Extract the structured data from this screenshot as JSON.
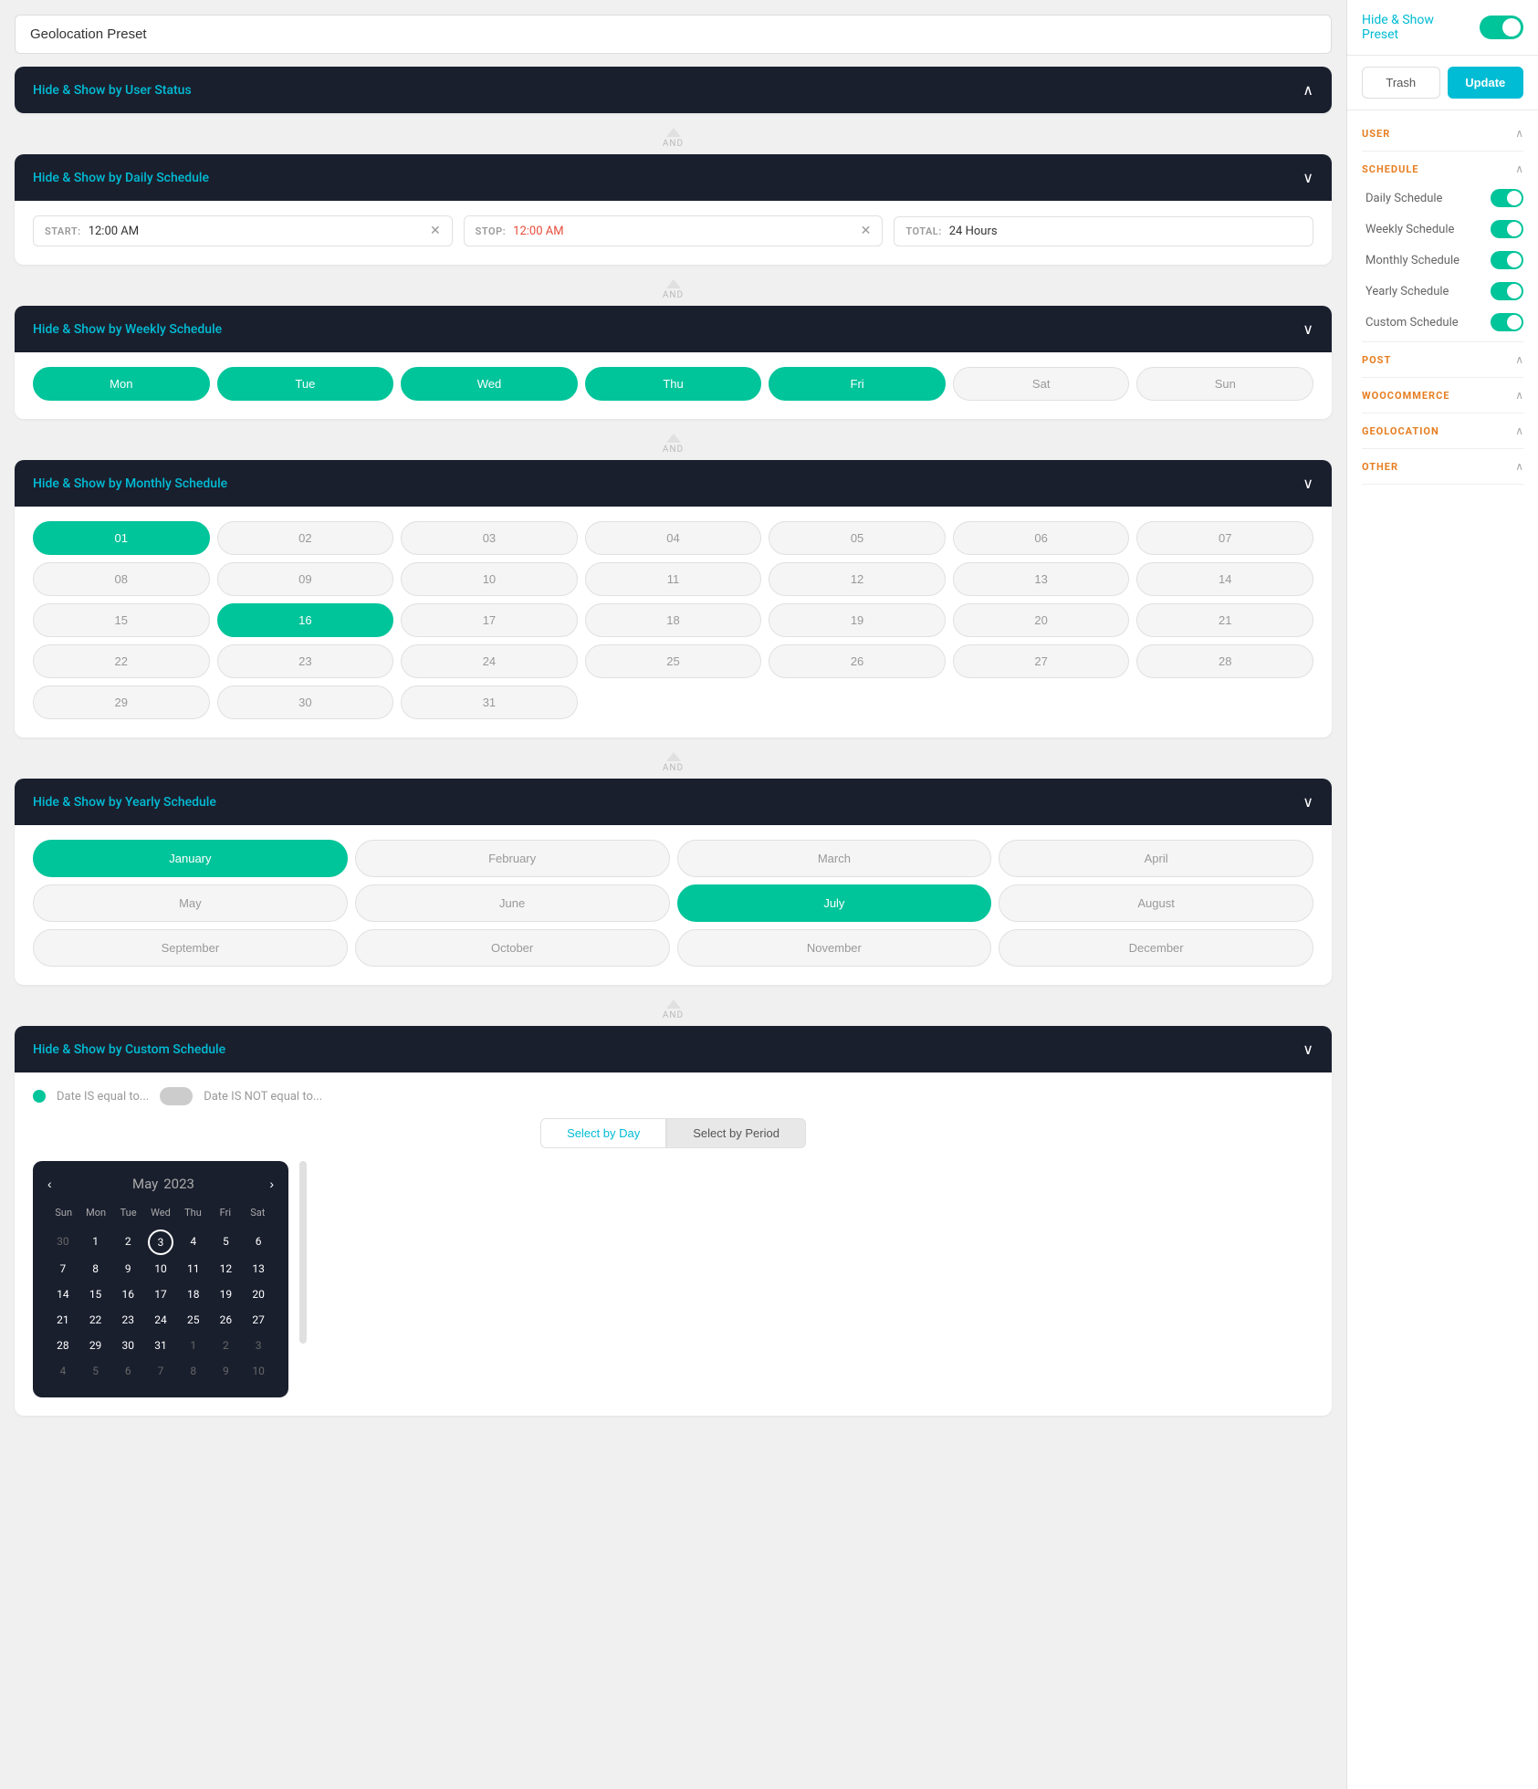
{
  "app": {
    "preset_title": "Geolocation Preset"
  },
  "left": {
    "user_status_header": {
      "title_prefix": "Hide & Show ",
      "title_highlight": "by User Status"
    },
    "daily_schedule": {
      "section_title_prefix": "Hide & Show ",
      "section_title_highlight": "by Daily Schedule",
      "start_label": "START:",
      "start_value": "12:00 AM",
      "stop_label": "STOP:",
      "stop_value": "12:00 AM",
      "stop_value_color": "red",
      "total_label": "TOTAL:",
      "total_value": "24 Hours"
    },
    "weekly_schedule": {
      "section_title_prefix": "Hide & Show ",
      "section_title_highlight": "by Weekly Schedule",
      "days": [
        {
          "label": "Mon",
          "active": true
        },
        {
          "label": "Tue",
          "active": true
        },
        {
          "label": "Wed",
          "active": true
        },
        {
          "label": "Thu",
          "active": true
        },
        {
          "label": "Fri",
          "active": true
        },
        {
          "label": "Sat",
          "active": false
        },
        {
          "label": "Sun",
          "active": false
        }
      ]
    },
    "monthly_schedule": {
      "section_title_prefix": "Hide & Show ",
      "section_title_highlight": "by Monthly Schedule",
      "days": [
        {
          "label": "01",
          "active": true
        },
        {
          "label": "02",
          "active": false
        },
        {
          "label": "03",
          "active": false
        },
        {
          "label": "04",
          "active": false
        },
        {
          "label": "05",
          "active": false
        },
        {
          "label": "06",
          "active": false
        },
        {
          "label": "07",
          "active": false
        },
        {
          "label": "08",
          "active": false
        },
        {
          "label": "09",
          "active": false
        },
        {
          "label": "10",
          "active": false
        },
        {
          "label": "11",
          "active": false
        },
        {
          "label": "12",
          "active": false
        },
        {
          "label": "13",
          "active": false
        },
        {
          "label": "14",
          "active": false
        },
        {
          "label": "15",
          "active": false
        },
        {
          "label": "16",
          "active": true
        },
        {
          "label": "17",
          "active": false
        },
        {
          "label": "18",
          "active": false
        },
        {
          "label": "19",
          "active": false
        },
        {
          "label": "20",
          "active": false
        },
        {
          "label": "21",
          "active": false
        },
        {
          "label": "22",
          "active": false
        },
        {
          "label": "23",
          "active": false
        },
        {
          "label": "24",
          "active": false
        },
        {
          "label": "25",
          "active": false
        },
        {
          "label": "26",
          "active": false
        },
        {
          "label": "27",
          "active": false
        },
        {
          "label": "28",
          "active": false
        },
        {
          "label": "29",
          "active": false
        },
        {
          "label": "30",
          "active": false
        },
        {
          "label": "31",
          "active": false
        }
      ]
    },
    "yearly_schedule": {
      "section_title_prefix": "Hide & Show ",
      "section_title_highlight": "by Yearly Schedule",
      "months": [
        {
          "label": "January",
          "active": true
        },
        {
          "label": "February",
          "active": false
        },
        {
          "label": "March",
          "active": false
        },
        {
          "label": "April",
          "active": false
        },
        {
          "label": "May",
          "active": false
        },
        {
          "label": "June",
          "active": false
        },
        {
          "label": "July",
          "active": true
        },
        {
          "label": "August",
          "active": false
        },
        {
          "label": "September",
          "active": false
        },
        {
          "label": "October",
          "active": false
        },
        {
          "label": "November",
          "active": false
        },
        {
          "label": "December",
          "active": false
        }
      ]
    },
    "custom_schedule": {
      "section_title_prefix": "Hide & Show ",
      "section_title_highlight": "by Custom Schedule",
      "date_is_equal_label": "Date IS equal to...",
      "date_not_equal_label": "Date IS NOT equal to...",
      "select_by_day": "Select by Day",
      "select_by_period": "Select by Period",
      "calendar": {
        "month": "May",
        "year": "2023",
        "day_headers": [
          "Sun",
          "Mon",
          "Tue",
          "Wed",
          "Thu",
          "Fri",
          "Sat"
        ],
        "weeks": [
          [
            {
              "label": "30",
              "faded": true
            },
            {
              "label": "1",
              "faded": false
            },
            {
              "label": "2",
              "faded": false
            },
            {
              "label": "3",
              "faded": false,
              "today": true
            },
            {
              "label": "4",
              "faded": false
            },
            {
              "label": "5",
              "faded": false
            },
            {
              "label": "6",
              "faded": false
            }
          ],
          [
            {
              "label": "7",
              "faded": false
            },
            {
              "label": "8",
              "faded": false
            },
            {
              "label": "9",
              "faded": false
            },
            {
              "label": "10",
              "faded": false
            },
            {
              "label": "11",
              "faded": false
            },
            {
              "label": "12",
              "faded": false
            },
            {
              "label": "13",
              "faded": false
            }
          ],
          [
            {
              "label": "14",
              "faded": false
            },
            {
              "label": "15",
              "faded": false
            },
            {
              "label": "16",
              "faded": false
            },
            {
              "label": "17",
              "faded": false
            },
            {
              "label": "18",
              "faded": false
            },
            {
              "label": "19",
              "faded": false
            },
            {
              "label": "20",
              "faded": false
            }
          ],
          [
            {
              "label": "21",
              "faded": false
            },
            {
              "label": "22",
              "faded": false
            },
            {
              "label": "23",
              "faded": false
            },
            {
              "label": "24",
              "faded": false
            },
            {
              "label": "25",
              "faded": false
            },
            {
              "label": "26",
              "faded": false
            },
            {
              "label": "27",
              "faded": false
            }
          ],
          [
            {
              "label": "28",
              "faded": false
            },
            {
              "label": "29",
              "faded": false
            },
            {
              "label": "30",
              "faded": false
            },
            {
              "label": "31",
              "faded": false
            },
            {
              "label": "1",
              "faded": true
            },
            {
              "label": "2",
              "faded": true
            },
            {
              "label": "3",
              "faded": true
            }
          ],
          [
            {
              "label": "4",
              "faded": true
            },
            {
              "label": "5",
              "faded": true
            },
            {
              "label": "6",
              "faded": true
            },
            {
              "label": "7",
              "faded": true
            },
            {
              "label": "8",
              "faded": true
            },
            {
              "label": "9",
              "faded": true
            },
            {
              "label": "10",
              "faded": true
            }
          ]
        ]
      }
    },
    "and_label": "AND"
  },
  "right": {
    "header": {
      "label_prefix": "Hide & Show ",
      "label_highlight": "Preset"
    },
    "trash_label": "Trash",
    "update_label": "Update",
    "nav_groups": [
      {
        "label": "USER",
        "expanded": true,
        "items": []
      },
      {
        "label": "SCHEDULE",
        "expanded": true,
        "items": [
          {
            "label": "Daily Schedule",
            "toggle": true
          },
          {
            "label": "Weekly Schedule",
            "toggle": true
          },
          {
            "label": "Monthly Schedule",
            "toggle": true
          },
          {
            "label": "Yearly Schedule",
            "toggle": true
          },
          {
            "label": "Custom Schedule",
            "toggle": true
          }
        ]
      },
      {
        "label": "POST",
        "expanded": true,
        "items": []
      },
      {
        "label": "WOOCOMMERCE",
        "expanded": true,
        "items": []
      },
      {
        "label": "GEOLOCATION",
        "expanded": true,
        "items": []
      },
      {
        "label": "OTHER",
        "expanded": true,
        "items": []
      }
    ]
  }
}
